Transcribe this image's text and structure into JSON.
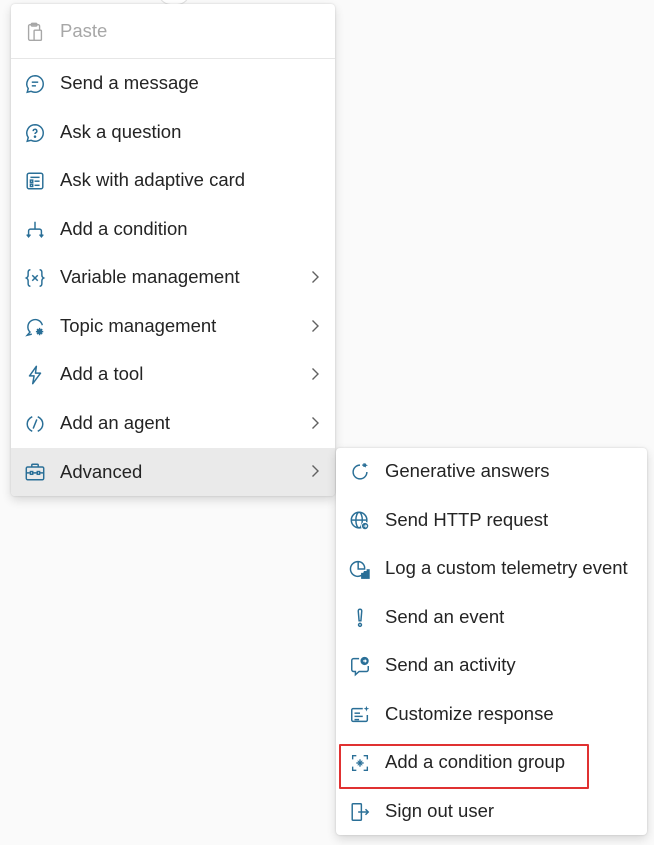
{
  "colors": {
    "icon": "#2a6f97",
    "text": "#242424",
    "disabled": "#a7a7a7",
    "active_bg": "#eaeaea",
    "highlight": "#e03131"
  },
  "main_menu": {
    "paste": {
      "label": "Paste",
      "icon": "clipboard-icon",
      "disabled": true
    },
    "items": [
      {
        "label": "Send a message",
        "icon": "chat-bubble-icon"
      },
      {
        "label": "Ask a question",
        "icon": "question-bubble-icon"
      },
      {
        "label": "Ask with adaptive card",
        "icon": "adaptive-card-icon"
      },
      {
        "label": "Add a condition",
        "icon": "branch-icon"
      },
      {
        "label": "Variable management",
        "icon": "variable-icon",
        "submenu": true
      },
      {
        "label": "Topic management",
        "icon": "topic-gear-icon",
        "submenu": true
      },
      {
        "label": "Add a tool",
        "icon": "lightning-icon",
        "submenu": true
      },
      {
        "label": "Add an agent",
        "icon": "agent-icon",
        "submenu": true
      },
      {
        "label": "Advanced",
        "icon": "toolbox-icon",
        "submenu": true,
        "active": true
      }
    ]
  },
  "sub_menu": {
    "items": [
      {
        "label": "Generative answers",
        "icon": "sparkle-refresh-icon"
      },
      {
        "label": "Send HTTP request",
        "icon": "globe-icon"
      },
      {
        "label": "Log a custom telemetry event",
        "icon": "telemetry-chart-icon"
      },
      {
        "label": "Send an event",
        "icon": "exclamation-icon"
      },
      {
        "label": "Send an activity",
        "icon": "activity-bubble-icon"
      },
      {
        "label": "Customize response",
        "icon": "customize-text-icon"
      },
      {
        "label": "Add a condition group",
        "icon": "condition-group-icon",
        "highlighted": true
      },
      {
        "label": "Sign out user",
        "icon": "sign-out-icon"
      }
    ]
  }
}
